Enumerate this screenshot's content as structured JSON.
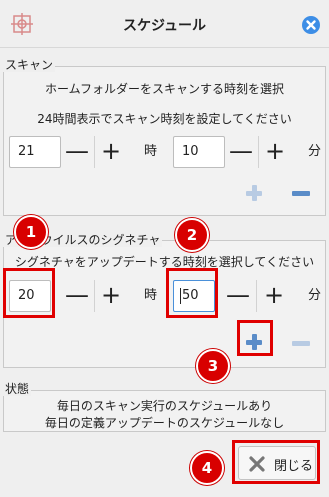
{
  "window": {
    "title": "スケジュール",
    "close_icon": "close-icon",
    "app_icon": "clamtk-icon"
  },
  "scan": {
    "group_title": "スキャン",
    "description1": "ホームフォルダーをスキャンする時刻を選択",
    "description2": "24時間表示でスキャン時刻を設定してください",
    "hour_value": "21",
    "hour_unit": "時",
    "minute_value": "10",
    "minute_unit": "分",
    "minus_label": "—",
    "plus_label": "+"
  },
  "antivirus": {
    "group_title": "アンチウイルスのシグネチャ",
    "description": "シグネチャをアップデートする時刻を選択してください",
    "hour_value": "20",
    "hour_unit": "時",
    "minute_value": "50",
    "minute_unit": "分",
    "minus_label": "—",
    "plus_label": "+"
  },
  "status": {
    "group_title": "状態",
    "line1": "毎日のスキャン実行のスケジュールあり",
    "line2": "毎日の定義アップデートのスケジュールなし"
  },
  "close_button": {
    "label": "閉じる"
  },
  "annotations": {
    "badge1": "1",
    "badge2": "2",
    "badge3": "3",
    "badge4": "4"
  },
  "colors": {
    "highlight": "#e00000",
    "accent_blue": "#3d8ee6",
    "action_blue": "#5a8cc8"
  }
}
